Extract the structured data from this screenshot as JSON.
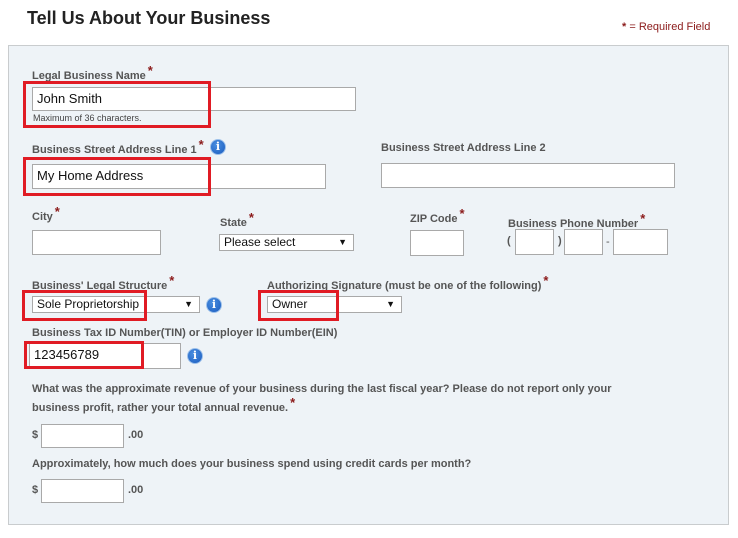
{
  "header": {
    "title": "Tell Us About Your Business",
    "required_star": "*",
    "required_note": " = Required Field"
  },
  "form": {
    "legal_name": {
      "label": "Legal Business Name",
      "value": "John Smith",
      "hint": "Maximum of 36 characters."
    },
    "address1": {
      "label": "Business Street Address Line 1",
      "value": "My Home Address"
    },
    "address2": {
      "label": "Business Street Address Line 2",
      "value": ""
    },
    "city": {
      "label": "City",
      "value": ""
    },
    "state": {
      "label": "State",
      "selected": "Please select"
    },
    "zip": {
      "label": "ZIP Code",
      "value": ""
    },
    "phone": {
      "label": "Business Phone Number",
      "open_paren": "(",
      "close_paren": ")",
      "dash": "-",
      "area": "",
      "prefix": "",
      "line": ""
    },
    "legal_structure": {
      "label": "Business' Legal Structure",
      "selected": "Sole Proprietorship"
    },
    "signature": {
      "label": "Authorizing Signature (must be one of the following)",
      "selected": "Owner"
    },
    "tax_id": {
      "label": "Business Tax ID Number(TIN) or Employer ID Number(EIN)",
      "value": "123456789"
    },
    "revenue": {
      "question_line1": "What was the approximate revenue of your business during the last fiscal year? Please do not report only your",
      "question_line2": "business profit, rather your total annual revenue.",
      "currency": "$",
      "cents": ".00",
      "value": ""
    },
    "card_spend": {
      "question": "Approximately, how much does your business spend using credit cards per month?",
      "currency": "$",
      "cents": ".00",
      "value": ""
    }
  },
  "icons": {
    "info_glyph": "i",
    "star": "*",
    "dropdown_arrow": "▼"
  },
  "colors": {
    "required": "#8b1a1a",
    "highlight": "#e01b24",
    "panel_bg": "#eef3f7",
    "info_blue": "#1a5bbf"
  }
}
